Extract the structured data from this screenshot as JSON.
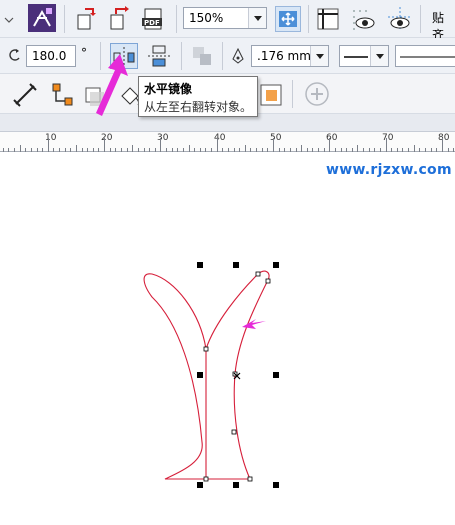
{
  "toolbar_top": {
    "zoom_value": "150%",
    "snap_label": "贴齐"
  },
  "property_bar": {
    "rotation_value": "180.0",
    "rotation_unit": "°",
    "outline_width_value": ".176 mm"
  },
  "tooltip": {
    "title": "水平镜像",
    "description": "从左至右翻转对象。"
  },
  "ruler": {
    "labels": [
      "10",
      "20",
      "30",
      "40",
      "50",
      "60",
      "70",
      "80"
    ]
  },
  "watermark": "www.rjzxw.com",
  "colors": {
    "toolbar_bg": "#eef1f6",
    "shape_outline": "#d61f3a",
    "arrow_accent": "#e62ad8",
    "watermark": "#1e6fd9",
    "handle": "#000000"
  },
  "icons": [
    "dropdown-arrow-icon",
    "import-icon",
    "export-icon",
    "publish-pdf-icon",
    "full-screen-preview-icon",
    "page-view-icon",
    "grid-view-icon",
    "guidelines-view-icon",
    "mirror-horizontal-icon",
    "mirror-vertical-icon",
    "align-icon",
    "outline-pen-icon",
    "line-style-icon",
    "dimension-tool-icon",
    "connector-tool-icon",
    "shadow-tool-icon",
    "fill-tool-icon",
    "add-icon"
  ]
}
